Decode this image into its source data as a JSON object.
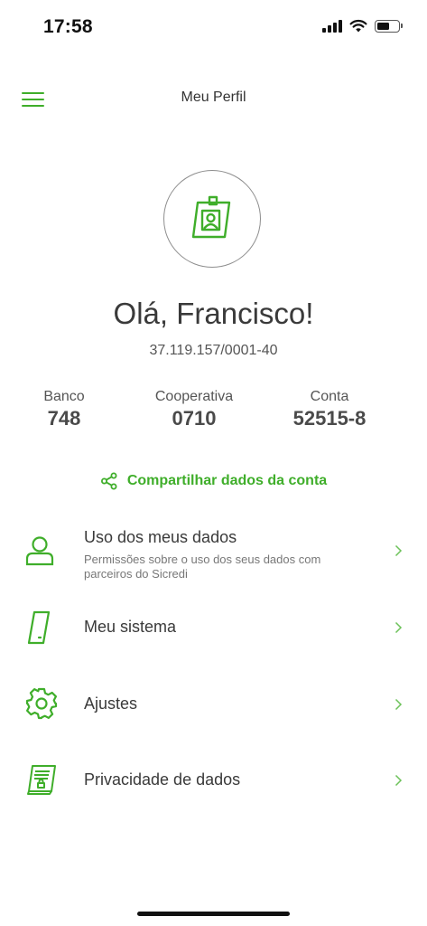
{
  "status_bar": {
    "time": "17:58",
    "battery_level": 0.6
  },
  "header": {
    "title": "Meu Perfil",
    "menu_icon": "hamburger-menu-icon"
  },
  "profile": {
    "avatar_icon": "id-badge-icon",
    "greeting": "Olá, Francisco!",
    "document": "37.119.157/0001-40"
  },
  "account": {
    "bank_label": "Banco",
    "bank_value": "748",
    "coop_label": "Cooperativa",
    "coop_value": "0710",
    "account_label": "Conta",
    "account_value": "52515-8"
  },
  "share": {
    "label": "Compartilhar dados da conta",
    "icon": "share-icon"
  },
  "menu": [
    {
      "title": "Uso dos meus dados",
      "description": "Permissões sobre o uso dos seus dados com parceiros do Sicredi",
      "icon": "user-icon"
    },
    {
      "title": "Meu sistema",
      "icon": "smartphone-icon"
    },
    {
      "title": "Ajustes",
      "icon": "gear-icon"
    },
    {
      "title": "Privacidade de dados",
      "icon": "document-lock-icon"
    }
  ],
  "colors": {
    "accent": "#3fae2a",
    "text": "#3a3a3a",
    "muted": "#777777"
  }
}
